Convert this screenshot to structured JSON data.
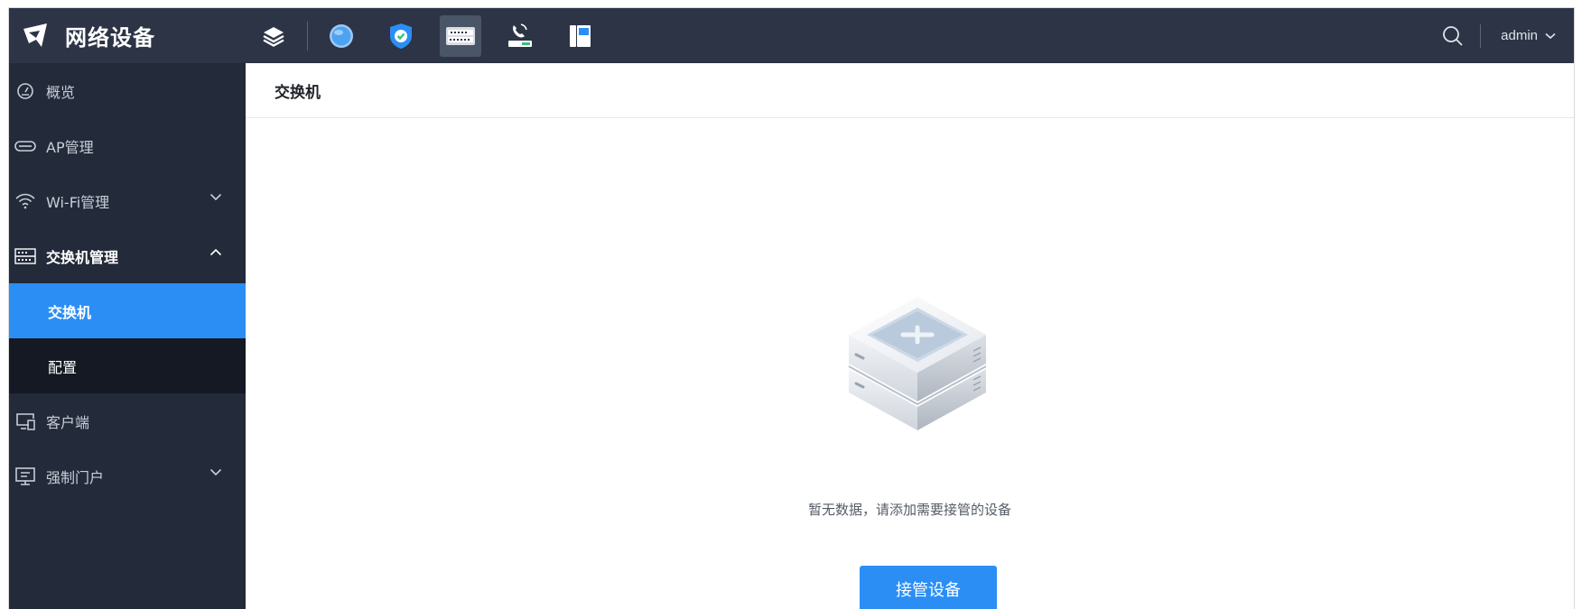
{
  "brand": {
    "title": "网络设备",
    "logo_icon": "brand-logo-icon"
  },
  "topbar": {
    "apps": [
      {
        "name": "layers-icon"
      },
      {
        "name": "globe-icon"
      },
      {
        "name": "shield-icon"
      },
      {
        "name": "switch-icon",
        "active": true
      },
      {
        "name": "ip-phone-icon"
      },
      {
        "name": "desk-phone-icon"
      }
    ],
    "search_icon": "search-icon",
    "user": "admin"
  },
  "sidebar": {
    "items": [
      {
        "label": "概览",
        "icon": "dashboard-icon"
      },
      {
        "label": "AP管理",
        "icon": "ap-icon"
      },
      {
        "label": "Wi-Fi管理",
        "icon": "wifi-icon",
        "expandable": true
      },
      {
        "label": "交换机管理",
        "icon": "switch-icon",
        "expanded": true,
        "children": [
          {
            "label": "交换机",
            "active": true
          },
          {
            "label": "配置"
          }
        ]
      },
      {
        "label": "客户端",
        "icon": "client-icon"
      },
      {
        "label": "强制门户",
        "icon": "portal-icon",
        "expandable": true
      }
    ]
  },
  "content": {
    "title": "交换机",
    "empty_message": "暂无数据，请添加需要接管的设备",
    "adopt_button": "接管设备"
  },
  "colors": {
    "topbar": "#2c3446",
    "sidebar": "#232a3a",
    "submenu": "#141923",
    "accent": "#2b8ef5"
  }
}
